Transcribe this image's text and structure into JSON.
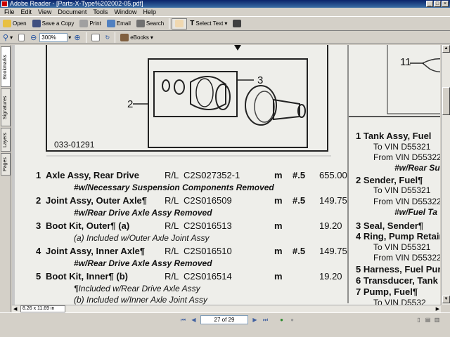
{
  "window": {
    "title": "Adobe Reader - [Parts-X-Type%202002-05.pdf]"
  },
  "menu": [
    "File",
    "Edit",
    "View",
    "Document",
    "Tools",
    "Window",
    "Help"
  ],
  "toolbar": {
    "open": "Open",
    "save_copy": "Save a Copy",
    "print": "Print",
    "email": "Email",
    "search": "Search",
    "select_text": "Select Text",
    "zoom": "300%",
    "ebooks": "eBooks"
  },
  "sidetabs": [
    "Bookmarks",
    "Signatures",
    "Layers",
    "Pages"
  ],
  "document": {
    "figure_id": "033-01291",
    "callouts": [
      "2",
      "3",
      "11"
    ],
    "left_items": [
      {
        "num": "1",
        "name": "Axle Assy, Rear Drive",
        "rl": "R/L",
        "part": "C2S027352-1",
        "unit": "m",
        "qty": "#.5",
        "price": "655.00"
      },
      {
        "note": "#w/Necessary Suspension Components Removed"
      },
      {
        "num": "2",
        "name": "Joint Assy, Outer Axle¶",
        "rl": "R/L",
        "part": "C2S016509",
        "unit": "m",
        "qty": "#.5",
        "price": "149.75"
      },
      {
        "note": "#w/Rear Drive Axle Assy Removed"
      },
      {
        "num": "3",
        "name": "Boot Kit, Outer¶ (a)",
        "rl": "R/L",
        "part": "C2S016513",
        "unit": "m",
        "qty": "",
        "price": "19.20"
      },
      {
        "sub": "(a) Included w/Outer Axle Joint Assy"
      },
      {
        "num": "4",
        "name": "Joint Assy, Inner Axle¶",
        "rl": "R/L",
        "part": "C2S016510",
        "unit": "m",
        "qty": "#.5",
        "price": "149.75"
      },
      {
        "note": "#w/Rear Drive Axle Assy Removed"
      },
      {
        "num": "5",
        "name": "Boot Kit, Inner¶ (b)",
        "rl": "R/L",
        "part": "C2S016514",
        "unit": "m",
        "qty": "",
        "price": "19.20"
      },
      {
        "sub": "¶Included w/Rear Drive Axle Assy"
      },
      {
        "sub": "(b) Included w/Inner Axle Joint Assy"
      }
    ],
    "right_items": [
      {
        "text": "1 Tank Assy, Fuel",
        "style": "bold"
      },
      {
        "text": "To VIN D55321",
        "style": "plain"
      },
      {
        "text": "From VIN D55322",
        "style": "plain"
      },
      {
        "text": "#w/Rear Su",
        "style": "bi"
      },
      {
        "text": "2 Sender, Fuel¶",
        "style": "bold"
      },
      {
        "text": "To VIN D55321",
        "style": "plain"
      },
      {
        "text": "From VIN D55322",
        "style": "plain"
      },
      {
        "text": "#w/Fuel Ta",
        "style": "bi"
      },
      {
        "text": "3 Seal, Sender¶",
        "style": "bold"
      },
      {
        "text": "4 Ring, Pump Retain",
        "style": "bold"
      },
      {
        "text": "To VIN D55321",
        "style": "plain"
      },
      {
        "text": "From VIN D55322",
        "style": "plain"
      },
      {
        "text": "5 Harness, Fuel Pur",
        "style": "bold"
      },
      {
        "text": "6 Transducer, Tank",
        "style": "bold"
      },
      {
        "text": "7 Pump, Fuel¶",
        "style": "bold"
      },
      {
        "text": "To VIN D5532",
        "style": "plain"
      }
    ]
  },
  "status": {
    "page_size": "8.26 x 11.69 in",
    "page_indicator": "27 of 29"
  }
}
